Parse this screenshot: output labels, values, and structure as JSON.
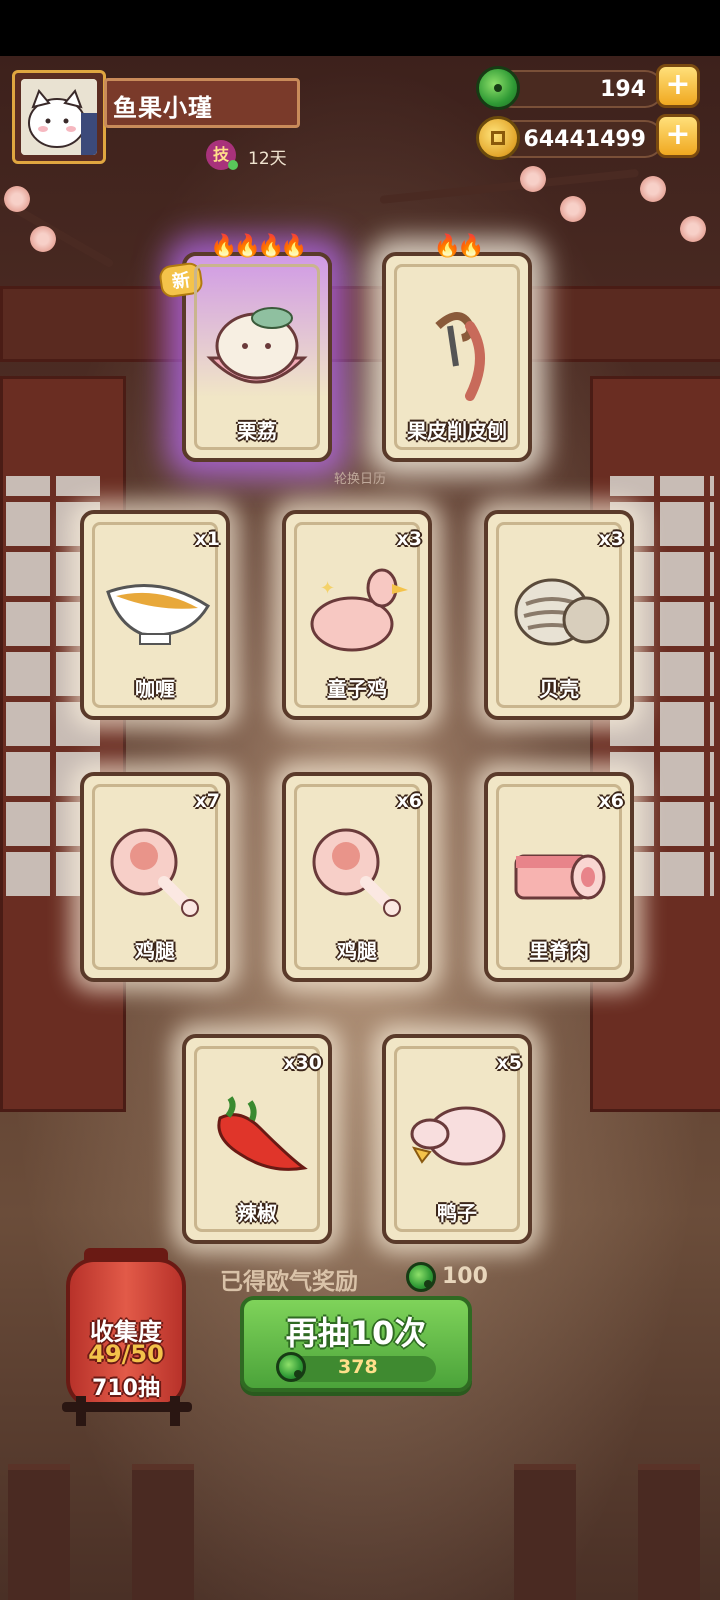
{
  "player": {
    "name": "鱼果小瑾",
    "skill_badge": "技",
    "skill_days": "12天"
  },
  "currencies": {
    "gems": "194",
    "coins": "64441499"
  },
  "rotation_label": "轮换日历",
  "featured_cards": [
    {
      "name": "栗荔",
      "badge": "新",
      "flames": 4,
      "art": "dumpling-bowl-icon"
    },
    {
      "name": "果皮削皮刨",
      "flames": 2,
      "art": "peeler-icon"
    }
  ],
  "cards": [
    {
      "name": "咖喱",
      "qty": "x1",
      "art": "curry-gravy-boat-icon"
    },
    {
      "name": "童子鸡",
      "qty": "x3",
      "art": "chicken-icon"
    },
    {
      "name": "贝壳",
      "qty": "x3",
      "art": "clam-shell-icon"
    },
    {
      "name": "鸡腿",
      "qty": "x7",
      "art": "drumstick-icon"
    },
    {
      "name": "鸡腿",
      "qty": "x6",
      "art": "drumstick-icon"
    },
    {
      "name": "里脊肉",
      "qty": "x6",
      "art": "tenderloin-icon"
    },
    {
      "name": "辣椒",
      "qty": "x30",
      "art": "chili-pepper-icon"
    },
    {
      "name": "鸭子",
      "qty": "x5",
      "art": "duck-icon"
    }
  ],
  "bonus": {
    "label": "已得欧气奖励",
    "value": "100"
  },
  "draw": {
    "label": "再抽10次",
    "cost": "378"
  },
  "collection": {
    "title": "收集度",
    "progress": "49/50",
    "draws": "710抽"
  }
}
